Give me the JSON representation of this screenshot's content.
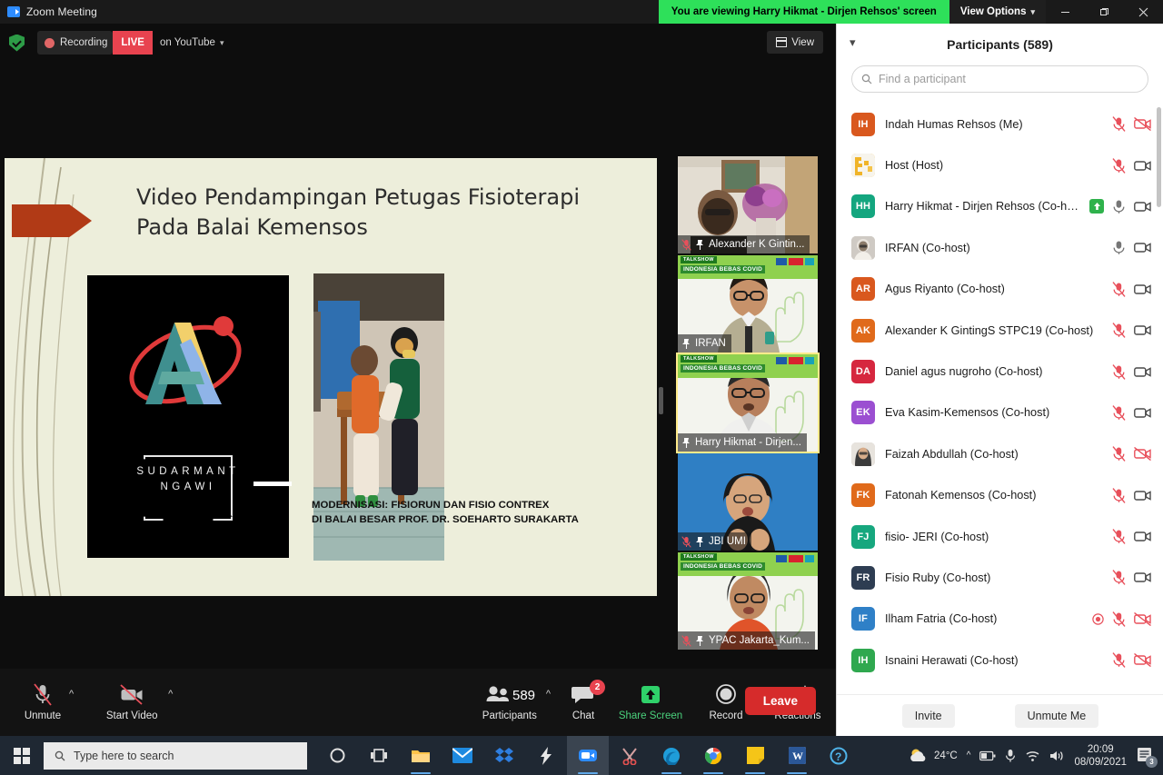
{
  "titlebar": {
    "app_title": "Zoom Meeting",
    "app_icon": "zoom-video-icon",
    "share_banner": "You are viewing Harry Hikmat - Dirjen Rehsos' screen",
    "view_options_label": "View Options",
    "minimize": "—",
    "maximize": "❐",
    "close": "✕"
  },
  "subbar": {
    "shield_icon": "encryption-shield-icon",
    "recording_label": "Recording",
    "live_badge": "LIVE",
    "live_destination": "on YouTube",
    "view_label": "View"
  },
  "slide": {
    "title": "Video Pendampingan Petugas Fisioterapi Pada Balai Kemensos",
    "logo_line1": "SUDARMANT",
    "logo_line2": "NGAWI",
    "caption_line1": "MODERNISASI: FISIORUN DAN FISIO CONTREX",
    "caption_line2": "DI BALAI BESAR PROF. DR. SOEHARTO SURAKARTA"
  },
  "filmstrip": [
    {
      "name": "Alexander K Gintin...",
      "muted": true,
      "pinned": true,
      "active": false,
      "style": "home"
    },
    {
      "name": "IRFAN",
      "muted": false,
      "pinned": true,
      "active": false,
      "style": "talkshow"
    },
    {
      "name": "Harry Hikmat - Dirjen...",
      "muted": false,
      "pinned": true,
      "active": true,
      "style": "talkshow"
    },
    {
      "name": "JBI UMI",
      "muted": true,
      "pinned": true,
      "active": false,
      "style": "blue"
    },
    {
      "name": "YPAC Jakarta_Kum...",
      "muted": true,
      "pinned": true,
      "active": false,
      "style": "talkshow"
    }
  ],
  "filmstrip_banner": {
    "line1": "TALKSHOW",
    "line2": "INDONESIA BEBAS COVID"
  },
  "toolbar": {
    "unmute_label": "Unmute",
    "start_video_label": "Start Video",
    "participants_label": "Participants",
    "participants_count": "589",
    "chat_label": "Chat",
    "chat_badge": "2",
    "share_label": "Share Screen",
    "record_label": "Record",
    "reactions_label": "Reactions",
    "leave_label": "Leave"
  },
  "participants_panel": {
    "title": "Participants (589)",
    "collapse_icon": "chevron-down-icon",
    "search_placeholder": "Find a participant",
    "search_value": "",
    "invite_label": "Invite",
    "unmute_me_label": "Unmute Me",
    "rows": [
      {
        "initials": "IH",
        "color": "#d9581e",
        "name": "Indah Humas Rehsos (Me)",
        "mic": "muted",
        "cam": "off",
        "raise": false,
        "rec": false
      },
      {
        "initials": "",
        "color": "#f0b429",
        "name": "Host (Host)",
        "mic": "muted",
        "cam": "on",
        "raise": false,
        "rec": false,
        "photo": "yellow"
      },
      {
        "initials": "HH",
        "color": "#14a67f",
        "name": "Harry Hikmat - Dirjen Rehsos (Co-host)",
        "mic": "on",
        "cam": "on",
        "raise": true,
        "rec": false
      },
      {
        "initials": "",
        "color": "#b9b2ab",
        "name": "IRFAN (Co-host)",
        "mic": "on",
        "cam": "on",
        "raise": false,
        "rec": false,
        "photo": "gray"
      },
      {
        "initials": "AR",
        "color": "#d9581e",
        "name": "Agus Riyanto (Co-host)",
        "mic": "muted",
        "cam": "on",
        "raise": false,
        "rec": false
      },
      {
        "initials": "AK",
        "color": "#e06a1b",
        "name": "Alexander K GintingS STPC19 (Co-host)",
        "mic": "muted",
        "cam": "on",
        "raise": false,
        "rec": false
      },
      {
        "initials": "DA",
        "color": "#d6273f",
        "name": "Daniel agus nugroho (Co-host)",
        "mic": "muted",
        "cam": "on",
        "raise": false,
        "rec": false
      },
      {
        "initials": "EK",
        "color": "#9b4fd1",
        "name": "Eva Kasim-Kemensos (Co-host)",
        "mic": "muted",
        "cam": "on",
        "raise": false,
        "rec": false
      },
      {
        "initials": "",
        "color": "#cfc9c4",
        "name": "Faizah Abdullah (Co-host)",
        "mic": "muted",
        "cam": "off",
        "raise": false,
        "rec": false,
        "photo": "hijab"
      },
      {
        "initials": "FK",
        "color": "#e06a1b",
        "name": "Fatonah Kemensos (Co-host)",
        "mic": "muted",
        "cam": "on",
        "raise": false,
        "rec": false
      },
      {
        "initials": "FJ",
        "color": "#16a77e",
        "name": "fisio- JERI (Co-host)",
        "mic": "muted",
        "cam": "on",
        "raise": false,
        "rec": false
      },
      {
        "initials": "FR",
        "color": "#2e3d52",
        "name": "Fisio Ruby (Co-host)",
        "mic": "muted",
        "cam": "on",
        "raise": false,
        "rec": false
      },
      {
        "initials": "IF",
        "color": "#2f80c7",
        "name": "Ilham Fatria (Co-host)",
        "mic": "muted",
        "cam": "off",
        "raise": false,
        "rec": true
      },
      {
        "initials": "IH",
        "color": "#2fa84f",
        "name": "Isnaini Herawati (Co-host)",
        "mic": "muted",
        "cam": "off",
        "raise": false,
        "rec": false
      }
    ]
  },
  "taskbar": {
    "start_icon": "windows-start-icon",
    "search_placeholder": "Type here to search",
    "apps": [
      {
        "name": "cortana-icon"
      },
      {
        "name": "task-view-icon"
      },
      {
        "name": "file-explorer-icon"
      },
      {
        "name": "mail-icon"
      },
      {
        "name": "dropbox-icon"
      },
      {
        "name": "lightning-app-icon"
      },
      {
        "name": "zoom-icon"
      },
      {
        "name": "snipping-tool-icon"
      },
      {
        "name": "edge-icon"
      },
      {
        "name": "chrome-icon"
      },
      {
        "name": "sticky-notes-icon"
      },
      {
        "name": "word-icon"
      },
      {
        "name": "help-icon"
      }
    ],
    "temperature": "24°C",
    "weather_icon": "partly-cloudy-icon",
    "time": "20:09",
    "date": "08/09/2021",
    "notification_count": "3"
  },
  "colors": {
    "zoom_blue": "#2d8cff",
    "share_green": "#2ee05a",
    "live_red": "#e8434f",
    "leave_red": "#d62b2b",
    "highlight_yellow": "#ffeb8a"
  }
}
